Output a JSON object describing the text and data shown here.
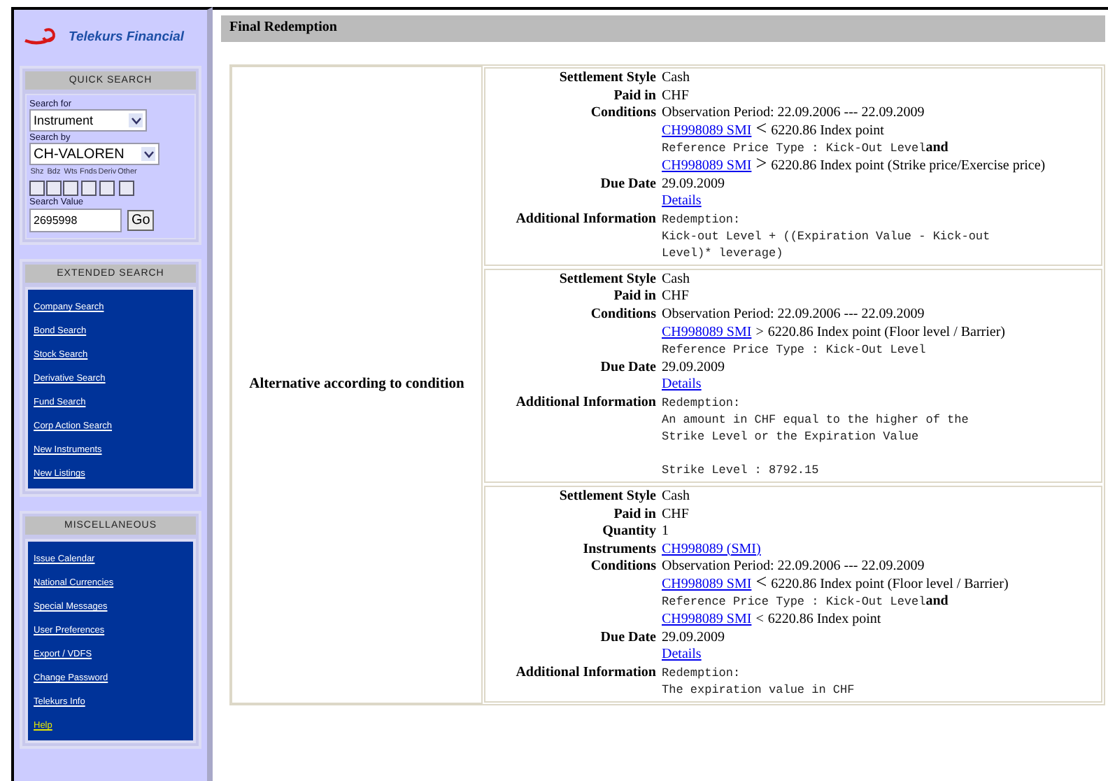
{
  "logo": {
    "text": "Telekurs Financial"
  },
  "quick_search": {
    "title": "QUICK SEARCH",
    "search_for_label": "Search for",
    "search_for": "Instrument",
    "search_by_label": "Search by",
    "search_by": "CH-VALOREN",
    "types": [
      {
        "label": "Shz",
        "checked": false
      },
      {
        "label": "Bdz",
        "checked": false
      },
      {
        "label": "Wts",
        "checked": false
      },
      {
        "label": "Fnds",
        "checked": false
      },
      {
        "label": "Deriv",
        "checked": false
      },
      {
        "label": "Other",
        "checked": false
      }
    ],
    "search_value_label": "Search Value",
    "search_value": "2695998",
    "go_button": "Go"
  },
  "extended_search": {
    "title": "EXTENDED SEARCH",
    "links": [
      {
        "label": "Company Search",
        "highlighted": false
      },
      {
        "label": "Bond Search",
        "highlighted": false
      },
      {
        "label": "Stock Search",
        "highlighted": false
      },
      {
        "label": "Derivative Search",
        "highlighted": false
      },
      {
        "label": "Fund Search",
        "highlighted": false
      },
      {
        "label": "Corp Action Search",
        "highlighted": false
      },
      {
        "label": "New Instruments",
        "highlighted": false
      },
      {
        "label": "New Listings",
        "highlighted": false
      }
    ]
  },
  "miscellaneous": {
    "title": "MISCELLANEOUS",
    "links": [
      {
        "label": "Issue Calendar",
        "highlighted": false
      },
      {
        "label": "National Currencies",
        "highlighted": false
      },
      {
        "label": "Special Messages",
        "highlighted": false
      },
      {
        "label": "User Preferences",
        "highlighted": false
      },
      {
        "label": "Export / VDFS",
        "highlighted": false
      },
      {
        "label": "Change Password",
        "highlighted": false
      },
      {
        "label": "Telekurs Info",
        "highlighted": false
      },
      {
        "label": "Help",
        "highlighted": true
      }
    ]
  },
  "section_title": "Final Redemption",
  "redemption": {
    "category": "Alternative according to condition",
    "alternatives": [
      {
        "rows": [
          {
            "label": "Settlement Style",
            "kind": "text",
            "value": "Cash"
          },
          {
            "label": "Paid in",
            "kind": "text",
            "value": "CHF"
          },
          {
            "label": "Conditions",
            "kind": "conditions",
            "lines": [
              {
                "kind": "text",
                "text": "Observation Period: 22.09.2006 --- 22.09.2009"
              },
              {
                "kind": "link",
                "link": "CH998089 SMI",
                "op": "<",
                "op_large": true,
                "text": "6220.86 Index point"
              },
              {
                "kind": "mono",
                "text": "Reference Price Type : Kick-Out Level",
                "joiner": "and"
              },
              {
                "kind": "link",
                "link": "CH998089 SMI",
                "op": ">",
                "op_large": true,
                "text": "6220.86 Index point (Strike price/Exercise price)"
              }
            ]
          },
          {
            "label": "Due Date",
            "kind": "date",
            "value": "29.09.2009",
            "link": "Details"
          },
          {
            "label": "Additional Information",
            "kind": "mono",
            "paragraphs": [
              [
                "Redemption:",
                "Kick-out Level + ((Expiration Value - Kick-out",
                "Level)* leverage)"
              ]
            ]
          }
        ]
      },
      {
        "rows": [
          {
            "label": "Settlement Style",
            "kind": "text",
            "value": "Cash"
          },
          {
            "label": "Paid in",
            "kind": "text",
            "value": "CHF"
          },
          {
            "label": "Conditions",
            "kind": "conditions",
            "lines": [
              {
                "kind": "text",
                "text": "Observation Period: 22.09.2006 --- 22.09.2009"
              },
              {
                "kind": "link",
                "link": "CH998089 SMI",
                "op": ">",
                "op_large": false,
                "text": "6220.86 Index point (Floor level / Barrier)"
              },
              {
                "kind": "mono",
                "text": "Reference Price Type : Kick-Out Level"
              }
            ]
          },
          {
            "label": "Due Date",
            "kind": "date",
            "value": "29.09.2009",
            "link": "Details"
          },
          {
            "label": "Additional Information",
            "kind": "mono",
            "paragraphs": [
              [
                "Redemption:",
                "An amount in CHF equal to the higher of the",
                "Strike Level or the Expiration Value"
              ],
              [
                "Strike Level : 8792.15"
              ]
            ]
          }
        ]
      },
      {
        "rows": [
          {
            "label": "Settlement Style",
            "kind": "text",
            "value": "Cash"
          },
          {
            "label": "Paid in",
            "kind": "text",
            "value": "CHF"
          },
          {
            "label": "Quantity",
            "kind": "text",
            "value": "1"
          },
          {
            "label": "Instruments",
            "kind": "link",
            "value": "CH998089 (SMI)"
          },
          {
            "label": "Conditions",
            "kind": "conditions",
            "lines": [
              {
                "kind": "text",
                "text": "Observation Period: 22.09.2006 --- 22.09.2009"
              },
              {
                "kind": "link",
                "link": "CH998089 SMI",
                "op": "<",
                "op_large": true,
                "text": "6220.86 Index point (Floor level / Barrier)"
              },
              {
                "kind": "mono",
                "text": "Reference Price Type : Kick-Out Level",
                "joiner": "and"
              },
              {
                "kind": "link",
                "link": "CH998089 SMI",
                "op": "<",
                "op_large": false,
                "text": "6220.86 Index point"
              }
            ]
          },
          {
            "label": "Due Date",
            "kind": "date",
            "value": "29.09.2009",
            "link": "Details"
          },
          {
            "label": "Additional Information",
            "kind": "mono",
            "paragraphs": [
              [
                "Redemption:",
                "The expiration value in CHF"
              ]
            ]
          }
        ]
      }
    ]
  }
}
